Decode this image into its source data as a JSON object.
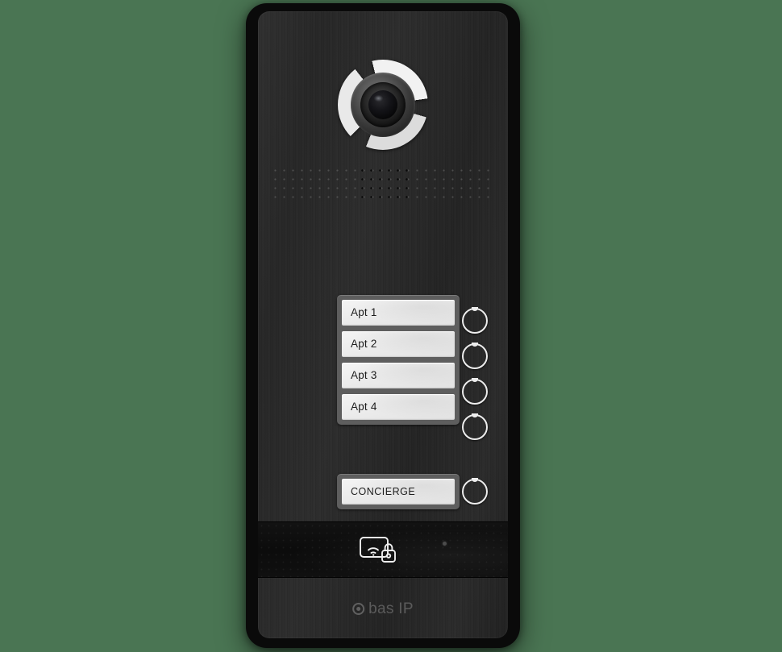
{
  "scene": {
    "device_name": "BAS-IP multi-apartment video door station",
    "background_color": "#4a7553",
    "panel_color": "#282828"
  },
  "camera": {
    "icon": "camera-lens-icon",
    "ring_color": "#eeeeee",
    "lens_color": "#0b0b0b"
  },
  "speaker": {
    "icon": "speaker-grille-icon"
  },
  "call_buttons": [
    {
      "label": "Apt 1",
      "button_icon": "call-ring-button-icon"
    },
    {
      "label": "Apt 2",
      "button_icon": "call-ring-button-icon"
    },
    {
      "label": "Apt 3",
      "button_icon": "call-ring-button-icon"
    },
    {
      "label": "Apt 4",
      "button_icon": "call-ring-button-icon"
    }
  ],
  "concierge": {
    "label": "CONCIERGE",
    "button_icon": "call-ring-button-icon"
  },
  "reader": {
    "icon": "rfid-card-lock-icon",
    "icon_color": "#f0f0f0",
    "led_icon": "status-led-icon",
    "led_color": "#4c4c4c",
    "panel_color": "#0e0e0e"
  },
  "brand": {
    "logo_mark_icon": "bas-ip-target-logo-icon",
    "name": "bas IP",
    "color": "#8f8f8f"
  }
}
